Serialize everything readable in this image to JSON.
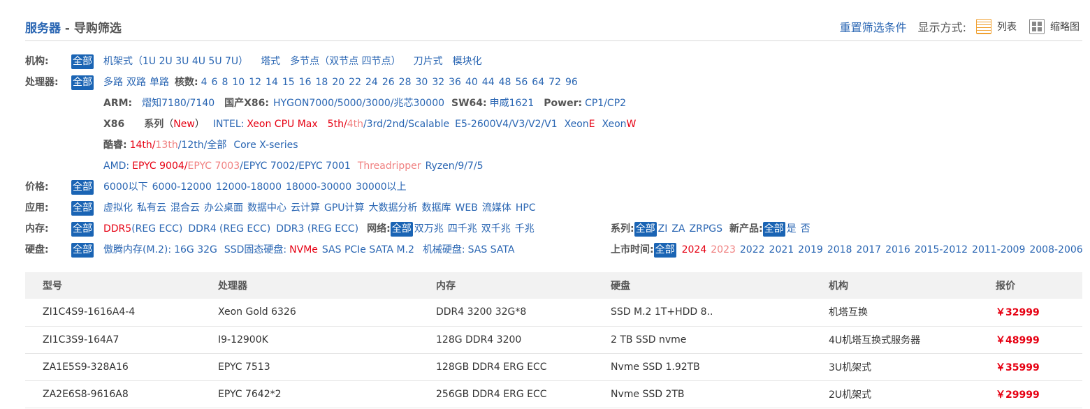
{
  "header": {
    "brand": "服务器",
    "sep": " - ",
    "title": "导购筛选",
    "reset": "重置筛选条件",
    "display_label": "显示方式:",
    "list_label": "列表",
    "thumb_label": "缩略图"
  },
  "all_label": "全部",
  "filters": {
    "jigou": {
      "label": "机构:",
      "items": [
        "机架式（1U 2U 3U 4U 5U 7U）",
        "塔式",
        "多节点（双节点 四节点）",
        "刀片式",
        "模块化"
      ]
    },
    "cpu": {
      "label": "处理器:",
      "ways": [
        "多路",
        "双路",
        "单路"
      ],
      "cores_label": "核数:",
      "cores": [
        "4",
        "6",
        "8",
        "10",
        "12",
        "14",
        "15",
        "16",
        "18",
        "20",
        "22",
        "24",
        "26",
        "28",
        "30",
        "32",
        "36",
        "40",
        "44",
        "48",
        "56",
        "64",
        "72",
        "96"
      ],
      "arm_label": "ARM:",
      "arm_items": "熠知7180/7140",
      "x86cn_label": "国产X86:",
      "x86cn_items": "HYGON7000/5000/3000/兆芯30000",
      "sw_label": "SW64:",
      "sw_items": "申威1621",
      "power_label": "Power:",
      "power_items": "CP1/CP2",
      "x86_label": "X86",
      "series_label": "系列",
      "series_open": "（",
      "series_new": "New",
      "series_close": "）",
      "intel_label": "INTEL:",
      "intel_xeon_max": "Xeon CPU Max",
      "intel_5th": "5th/",
      "intel_4th": "4th",
      "intel_rest": "/3rd/2nd/Scalable",
      "intel_e5": "E5-2600V4/V3/V2/V1",
      "intel_xeon_e": "Xeon E",
      "intel_xeon_w": "Xeon W",
      "core_label": "酷睿:",
      "core_14th": "14th/",
      "core_13th": "13th",
      "core_rest": "/12th/全部",
      "core_x": "Core X-series",
      "amd_label": "AMD:",
      "amd_9004": "EPYC 9004/",
      "amd_7003": "EPYC 7003",
      "amd_rest": "/EPYC 7002/EPYC 7001",
      "amd_tr": "Threadripper",
      "amd_ryzen": "Ryzen/9/7/5"
    },
    "price": {
      "label": "价格:",
      "items": [
        "6000以下",
        "6000-12000",
        "12000-18000",
        "18000-30000",
        "30000以上"
      ]
    },
    "app": {
      "label": "应用:",
      "items": [
        "虚拟化",
        "私有云",
        "混合云",
        "办公桌面",
        "数据中心",
        "云计算",
        "GPU计算",
        "大数据分析",
        "数据库",
        "WEB",
        "流媒体",
        "HPC"
      ]
    },
    "memory": {
      "label": "内存:",
      "ddr5": "DDR5",
      "ddr5_tail": " (REG ECC)",
      "items": [
        "DDR4 (REG ECC)",
        "DDR3 (REG ECC)"
      ]
    },
    "network": {
      "label": "网络:",
      "items": [
        "双万兆",
        "四千兆",
        "双千兆",
        "千兆"
      ]
    },
    "series": {
      "label": "系列:",
      "items": [
        "ZI",
        "ZA",
        "ZRPGS"
      ]
    },
    "newproduct": {
      "label": "新产品:",
      "items": [
        "是",
        "否"
      ]
    },
    "disk": {
      "label": "硬盘:",
      "aoteng": "傲腾内存(M.2):",
      "aoteng_items": "16G 32G",
      "ssd": "SSD固态硬盘:",
      "ssd_nvme": "NVMe",
      "ssd_rest": "SAS PCIe SATA M.2",
      "hdd": "机械硬盘:",
      "hdd_items": "SAS SATA"
    },
    "release": {
      "label": "上市时间:",
      "y2024": "2024",
      "y2023": "2023",
      "items": [
        "2022",
        "2021",
        "2019",
        "2018",
        "2017",
        "2016",
        "2015-2012",
        "2011-2009",
        "2008-2006"
      ]
    }
  },
  "table": {
    "headers": [
      "型号",
      "处理器",
      "内存",
      "硬盘",
      "机构",
      "报价"
    ],
    "rows": [
      [
        "ZI1C4S9-1616A4-4",
        "Xeon Gold 6326",
        "DDR4 3200 32G*8",
        "SSD M.2 1T+HDD 8..",
        "机塔互换",
        "￥32999"
      ],
      [
        "ZI1C3S9-164A7",
        "I9-12900K",
        "128G DDR4 3200",
        "2 TB SSD nvme",
        "4U机塔互换式服务器",
        "￥48999"
      ],
      [
        "ZA1E5S9-328A16",
        "EPYC 7513",
        "128GB DDR4 ERG ECC",
        "Nvme SSD 1.92TB",
        "3U机架式",
        "￥35999"
      ],
      [
        "ZA2E6S8-9616A8",
        "EPYC 7642*2",
        "256GB DDR4 ERG ECC",
        "Nvme SSD 2TB",
        "2U机架式",
        "￥29999"
      ]
    ]
  }
}
